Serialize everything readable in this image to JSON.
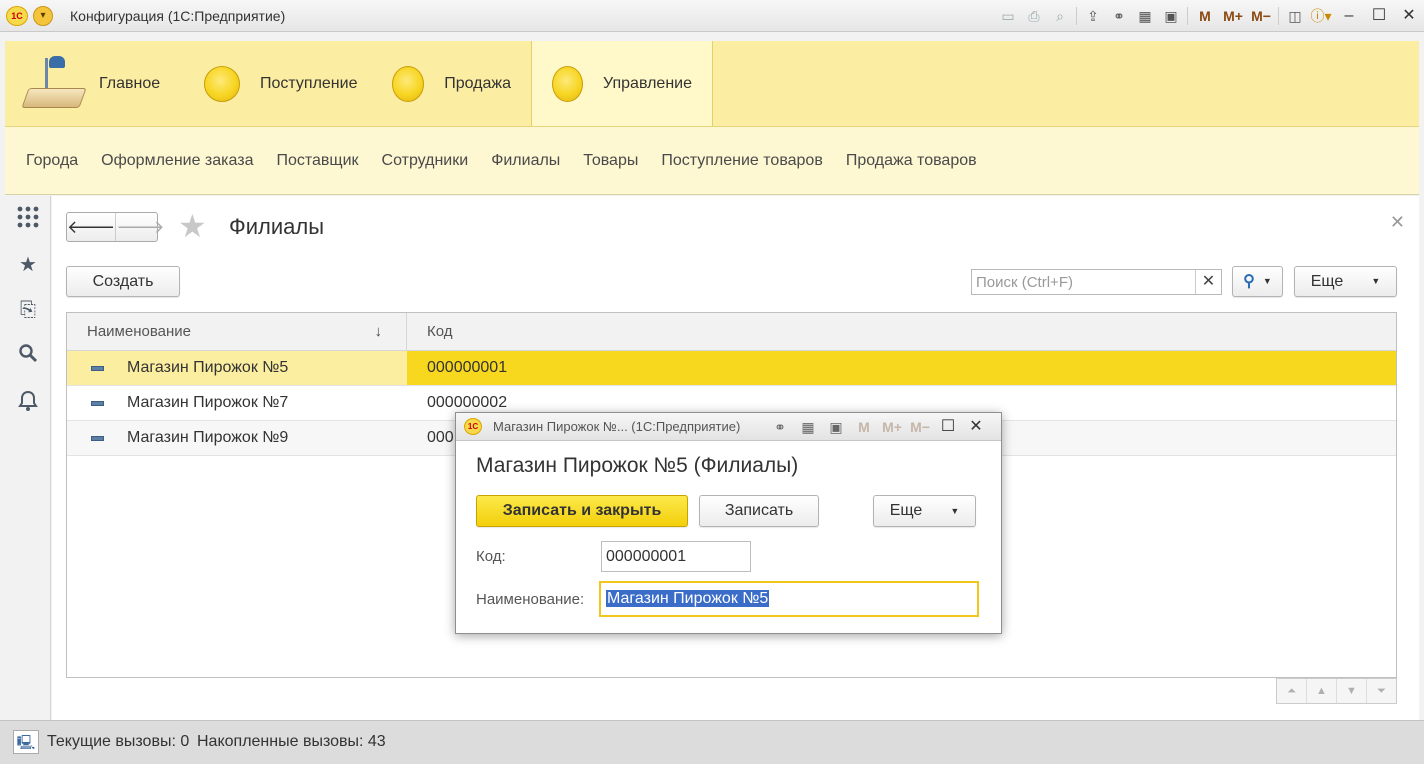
{
  "window": {
    "title": "Конфигурация  (1С:Предприятие)",
    "logo_text": "1С"
  },
  "sections": [
    {
      "label": "Главное",
      "icon": "desk-lamp-icon",
      "active": false
    },
    {
      "label": "Поступление",
      "icon": "circle-icon",
      "active": false
    },
    {
      "label": "Продажа",
      "icon": "circle-icon",
      "active": false
    },
    {
      "label": "Управление",
      "icon": "circle-icon",
      "active": true
    }
  ],
  "functions": [
    "Города",
    "Оформление заказа",
    "Поставщик",
    "Сотрудники",
    "Филиалы",
    "Товары",
    "Поступление товаров",
    "Продажа товаров"
  ],
  "form": {
    "title": "Филиалы",
    "create_label": "Создать",
    "search_placeholder": "Поиск (Ctrl+F)",
    "more_label": "Еще",
    "columns": {
      "name": "Наименование",
      "code": "Код"
    },
    "rows": [
      {
        "name": "Магазин Пирожок №5",
        "code": "000000001",
        "selected": true
      },
      {
        "name": "Магазин Пирожок №7",
        "code": "000000002",
        "selected": false
      },
      {
        "name": "Магазин Пирожок №9",
        "code": "000",
        "selected": false
      }
    ]
  },
  "status": {
    "current_calls": "Текущие вызовы: 0",
    "accumulated_calls": "Накопленные вызовы: 43"
  },
  "dialog": {
    "window_title": "Магазин Пирожок №...  (1С:Предприятие)",
    "heading": "Магазин Пирожок №5 (Филиалы)",
    "save_close_label": "Записать и закрыть",
    "save_label": "Записать",
    "more_label": "Еще",
    "code_label": "Код:",
    "code_value": "000000001",
    "name_label": "Наименование:",
    "name_value": "Магазин Пирожок №5"
  },
  "toolbar_memory": {
    "m": "M",
    "m_plus": "M+",
    "m_minus": "M−"
  },
  "colors": {
    "sections_bg": "#fbeda2",
    "selection": "#f8d81f",
    "primary_button": "#f3cf0b"
  }
}
